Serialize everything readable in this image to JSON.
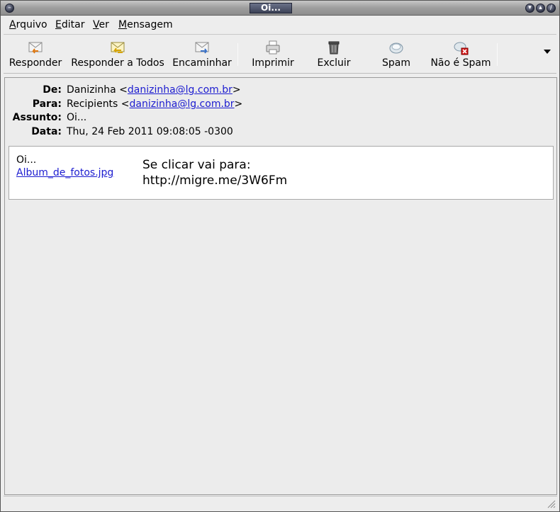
{
  "window": {
    "title": "Oi..."
  },
  "menu": {
    "arquivo": {
      "first": "A",
      "rest": "rquivo"
    },
    "editar": {
      "first": "E",
      "rest": "ditar"
    },
    "ver": {
      "first": "V",
      "rest": "er"
    },
    "mensagem": {
      "first": "M",
      "rest": "ensagem"
    }
  },
  "toolbar": {
    "reply": "Responder",
    "reply_all": "Responder a Todos",
    "forward": "Encaminhar",
    "print": "Imprimir",
    "delete": "Excluir",
    "spam": "Spam",
    "not_spam": "Não é Spam"
  },
  "header": {
    "from_key": "De:",
    "from_name": "Danizinha <",
    "from_email": "danizinha@lg.com.br",
    "from_close": ">",
    "to_key": "Para:",
    "to_name": "Recipients <",
    "to_email": "danizinha@lg.com.br",
    "to_close": ">",
    "subject_key": "Assunto:",
    "subject": "Oi...",
    "date_key": "Data:",
    "date": "Thu, 24 Feb 2011 09:08:05 -0300"
  },
  "body": {
    "greeting": "Oi...",
    "attachment": "Album_de_fotos.jpg",
    "line1": "Se clicar vai para:",
    "line2": "http://migre.me/3W6Fm"
  },
  "icons": {
    "reply": "mail-reply-icon",
    "reply_all": "mail-reply-all-icon",
    "forward": "mail-forward-icon",
    "print": "printer-icon",
    "delete": "trash-icon",
    "spam": "spam-icon",
    "not_spam": "not-spam-icon"
  }
}
